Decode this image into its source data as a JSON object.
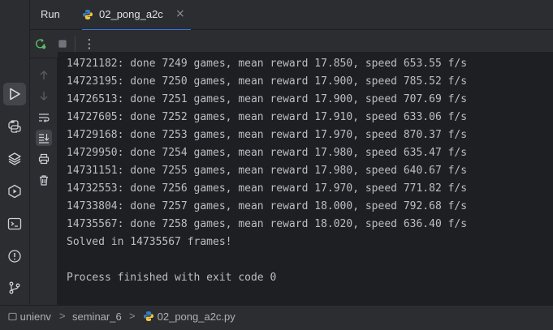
{
  "run_panel": {
    "title": "Run",
    "tab": {
      "label": "02_pong_a2c",
      "close_glyph": "×",
      "icon": "python-icon"
    }
  },
  "toolbar": {
    "rerun_icon": "rerun-icon",
    "stop_icon": "stop-icon",
    "more_glyph": "⋮"
  },
  "console": {
    "lines": [
      "14721182: done 7249 games, mean reward 17.850, speed 653.55 f/s",
      "14723195: done 7250 games, mean reward 17.900, speed 785.52 f/s",
      "14726513: done 7251 games, mean reward 17.900, speed 707.69 f/s",
      "14727605: done 7252 games, mean reward 17.910, speed 633.06 f/s",
      "14729168: done 7253 games, mean reward 17.970, speed 870.37 f/s",
      "14729950: done 7254 games, mean reward 17.980, speed 635.47 f/s",
      "14731151: done 7255 games, mean reward 17.980, speed 640.67 f/s",
      "14732553: done 7256 games, mean reward 17.970, speed 771.82 f/s",
      "14733804: done 7257 games, mean reward 18.000, speed 792.68 f/s",
      "14735567: done 7258 games, mean reward 18.020, speed 636.40 f/s",
      "Solved in 14735567 frames!",
      "",
      "Process finished with exit code 0"
    ]
  },
  "breadcrumb": {
    "project": "unienv",
    "folder": "seminar_6",
    "file": "02_pong_a2c.py",
    "separator": ">"
  },
  "colors": {
    "accent": "#3574f0",
    "background": "#1e1f22",
    "panel": "#2b2d30"
  }
}
